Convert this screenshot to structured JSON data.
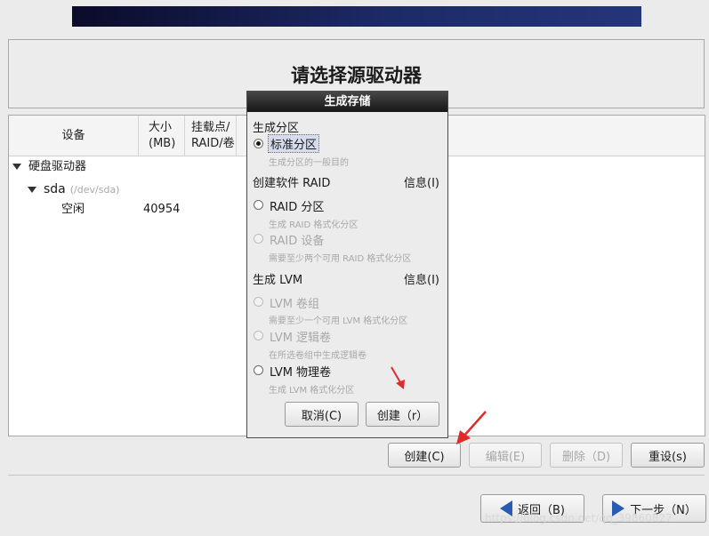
{
  "page": {
    "title": "请选择源驱动器"
  },
  "table": {
    "columns": [
      "设备",
      "大小\n(MB)",
      "挂载点/\nRAID/卷"
    ],
    "rows": {
      "group": "硬盘驱动器",
      "disk_name": "sda",
      "disk_path": "(/dev/sda)",
      "free_label": "空闲",
      "free_size": "40954"
    }
  },
  "actions": {
    "create": "创建(C)",
    "edit": "编辑(E)",
    "delete": "删除（D)",
    "reset": "重设(s)"
  },
  "nav": {
    "back": "返回（B)",
    "next": "下一步（N）"
  },
  "dialog": {
    "title": "生成存储",
    "section_partition": "生成分区",
    "standard_partition": "标准分区",
    "standard_partition_hint": "生成分区的一般目的",
    "section_raid": "创建软件 RAID",
    "info_label": "信息(I)",
    "raid_partition": "RAID 分区",
    "raid_partition_hint": "生成 RAID 格式化分区",
    "raid_device": "RAID 设备",
    "raid_device_hint": "需要至少两个可用 RAID 格式化分区",
    "section_lvm": "生成 LVM",
    "lvm_vg": "LVM 卷组",
    "lvm_vg_hint": "需要至少一个可用 LVM 格式化分区",
    "lvm_lv": "LVM 逻辑卷",
    "lvm_lv_hint": "在所选卷组中生成逻辑卷",
    "lvm_pv": "LVM 物理卷",
    "lvm_pv_hint": "生成 LVM 格式化分区",
    "cancel": "取消(C)",
    "create": "创建（r）"
  },
  "watermark": "https://blog.csdn.net/qq_39860827",
  "colors": {
    "accent": "#2a5bb3",
    "annotation": "#e02b2b"
  }
}
